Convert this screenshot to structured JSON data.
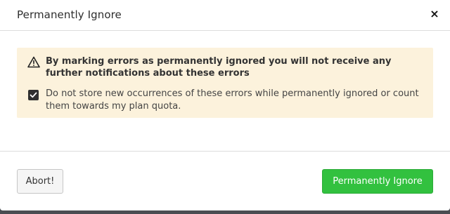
{
  "modal": {
    "title": "Permanently Ignore",
    "close_symbol": "×"
  },
  "alert": {
    "icon": "warning-icon",
    "message": "By marking errors as permanently ignored you will not receive any further notifications about these errors",
    "checkbox": {
      "checked": true,
      "label": "Do not store new occurrences of these errors while permanently ignored or count them towards my plan quota."
    }
  },
  "footer": {
    "abort_label": "Abort!",
    "confirm_label": "Permanently Ignore"
  },
  "colors": {
    "alert_background": "#fcf2dc",
    "confirm_button": "#32c13f",
    "backdrop": "#4a4d52"
  }
}
